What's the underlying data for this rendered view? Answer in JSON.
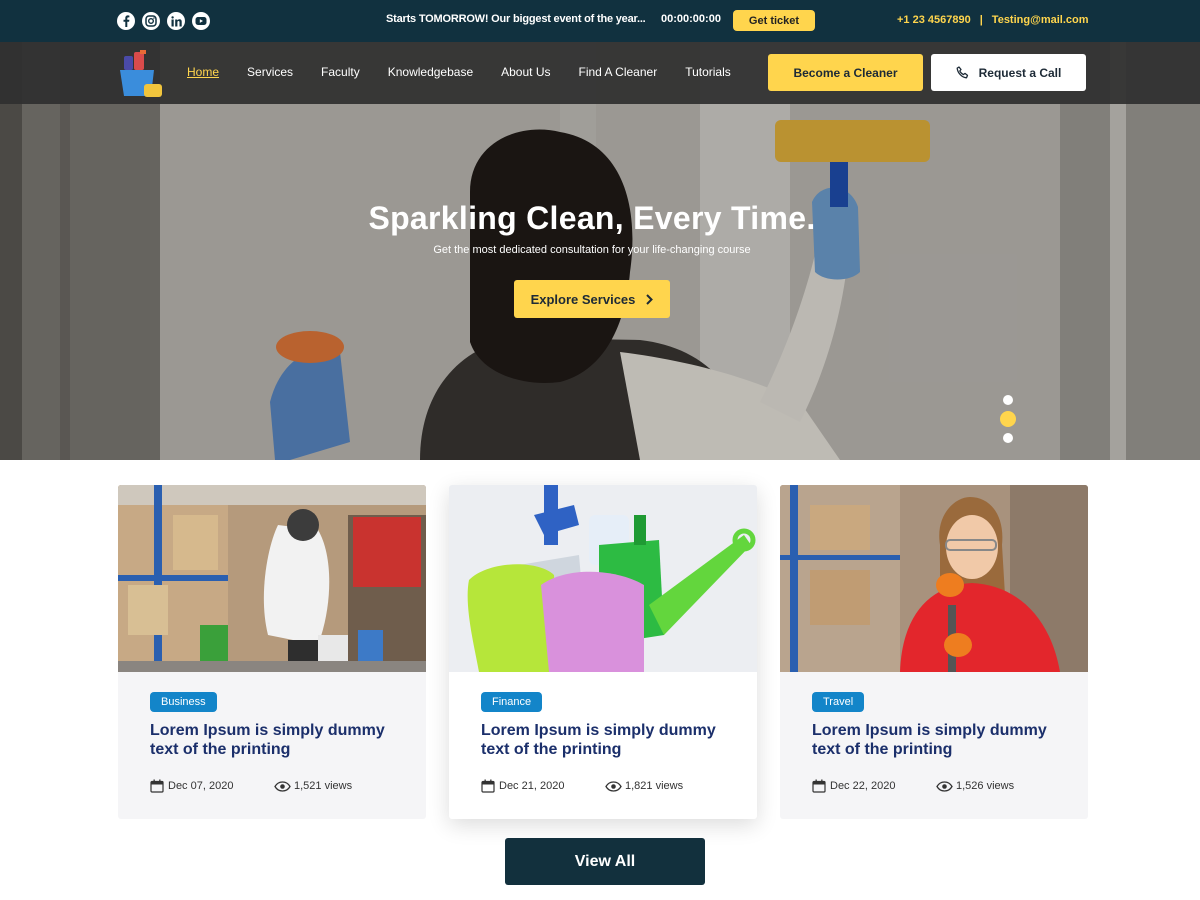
{
  "topbar": {
    "social": [
      "facebook-icon",
      "instagram-icon",
      "linkedin-icon",
      "youtube-icon"
    ],
    "promo": "Starts TOMORROW! Our biggest event of the year...",
    "timer": "00:00:00:00",
    "ticket_label": "Get ticket",
    "phone": "+1 23 4567890",
    "separator": "|",
    "email": "Testing@mail.com"
  },
  "nav": {
    "items": [
      "Home",
      "Services",
      "Faculty",
      "Knowledgebase",
      "About Us",
      "Find A Cleaner",
      "Tutorials"
    ],
    "active": "Home",
    "become_label": "Become a Cleaner",
    "call_label": "Request a Call"
  },
  "hero": {
    "title": "Sparkling Clean, Every Time.",
    "subtitle": "Get the most dedicated consultation for your life-changing course",
    "cta": "Explore Services",
    "slides": 3,
    "active_slide": 2
  },
  "cards": [
    {
      "tag": "Business",
      "title": "Lorem Ipsum is simply dummy text of the printing",
      "date": "Dec 07, 2020",
      "views": "1,521 views"
    },
    {
      "tag": "Finance",
      "title": "Lorem Ipsum is simply dummy text of the printing",
      "date": "Dec 21, 2020",
      "views": "1,821 views"
    },
    {
      "tag": "Travel",
      "title": "Lorem Ipsum is simply dummy text of the printing",
      "date": "Dec 22, 2020",
      "views": "1,526 views"
    }
  ],
  "view_all": "View All",
  "colors": {
    "topbar": "#11313f",
    "accent": "#ffd54d",
    "tag": "#1385c9",
    "card_title": "#1b2f6b",
    "view_all": "#12303d"
  }
}
